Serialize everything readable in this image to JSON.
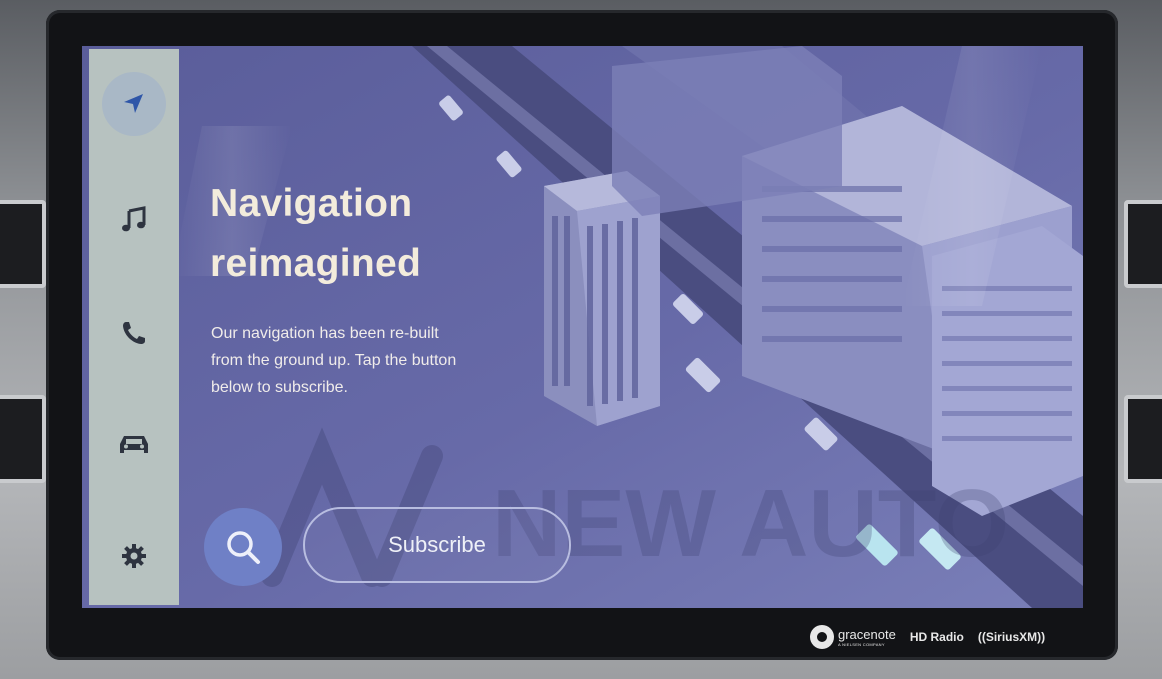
{
  "sidebar": {
    "items": [
      {
        "icon": "navigation-arrow-icon",
        "active": true
      },
      {
        "icon": "music-note-icon"
      },
      {
        "icon": "phone-icon"
      },
      {
        "icon": "car-icon"
      },
      {
        "icon": "settings-gear-icon"
      }
    ]
  },
  "main": {
    "headline_line1": "Navigation",
    "headline_line2": "reimagined",
    "desc_line1": "Our navigation has been re-built",
    "desc_line2": "from the ground up. Tap the button",
    "desc_line3": "below to subscribe.",
    "search_icon": "search-icon",
    "subscribe_label": "Subscribe"
  },
  "watermark": "NEW AUTO",
  "brands": {
    "gracenote": "gracenote",
    "gracenote_sub": "A NIELSEN COMPANY",
    "hdradio": "HD Radio",
    "siriusxm": "((SiriusXM))"
  },
  "colors": {
    "screen_bg": "#5b5f9c",
    "sidebar_bg": "#b7c2c0",
    "icon": "#2e3440",
    "accent": "#6f80c6",
    "headline": "#f3ecdc"
  }
}
